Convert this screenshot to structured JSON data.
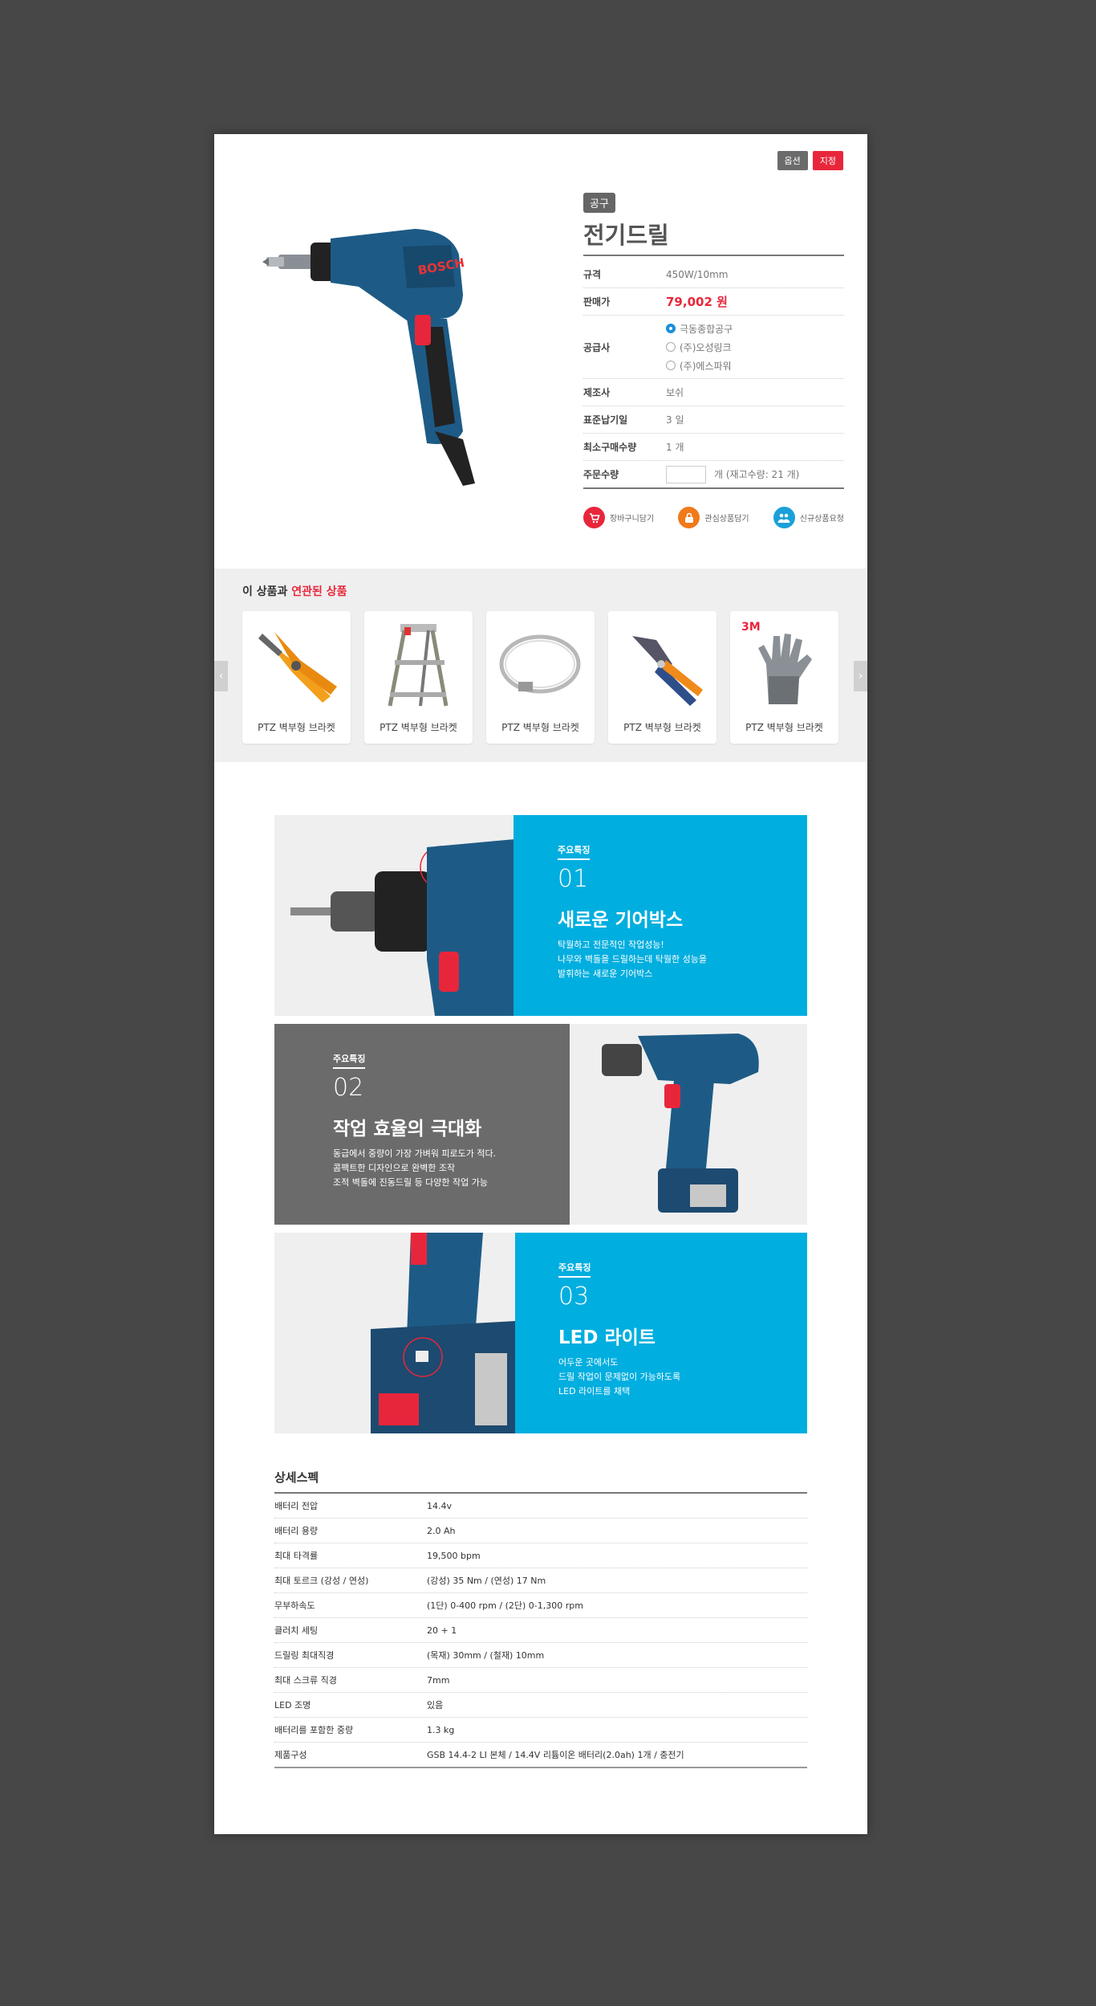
{
  "badges": {
    "option": "옵션",
    "designated": "지정"
  },
  "product": {
    "category": "공구",
    "title": "전기드릴",
    "spec_label": "규격",
    "spec_value": "450W/10mm",
    "price_label": "판매가",
    "price_value": "79,002 원",
    "supplier_label": "공급사",
    "suppliers": [
      {
        "name": "극동종합공구",
        "selected": true
      },
      {
        "name": "(주)오성링크",
        "selected": false
      },
      {
        "name": "(주)에스파워",
        "selected": false
      }
    ],
    "maker_label": "제조사",
    "maker_value": "보쉬",
    "leadtime_label": "표준납기일",
    "leadtime_value": "3 일",
    "minqty_label": "최소구매수량",
    "minqty_value": "1 개",
    "orderqty_label": "주문수량",
    "orderqty_suffix": "개 (재고수량: 21 개)"
  },
  "actions": {
    "cart": "장바구니담기",
    "wish": "관심상품담기",
    "request": "신규상품요청"
  },
  "related": {
    "title_prefix": "이 상품과 ",
    "title_highlight": "연관된 상품",
    "items": [
      {
        "name": "PTZ 벽부형 브라켓",
        "icon": "pliers"
      },
      {
        "name": "PTZ 벽부형 브라켓",
        "icon": "step-ladder"
      },
      {
        "name": "PTZ 벽부형 브라켓",
        "icon": "hose-clamp"
      },
      {
        "name": "PTZ 벽부형 브라켓",
        "icon": "crimping-tool"
      },
      {
        "name": "PTZ 벽부형 브라켓",
        "icon": "work-glove"
      }
    ]
  },
  "features": [
    {
      "label": "주요특징",
      "num": "01",
      "title": "새로운 기어박스",
      "desc": [
        "탁월하고 전문적인 작업성능!",
        "나무와 벽돌을 드릴하는데 탁월한 성능을",
        "발휘하는 새로운 기어박스"
      ]
    },
    {
      "label": "주요특징",
      "num": "02",
      "title": "작업 효율의 극대화",
      "desc": [
        "동급에서 중량이 가장 가벼워 피로도가 적다.",
        "콤팩트한 디자인으로 완벽한 조작",
        "조적 벽돌에 진동드릴 등 다양한 작업 가능"
      ]
    },
    {
      "label": "주요특징",
      "num": "03",
      "title": "LED 라이트",
      "desc": [
        "어두운 곳에서도",
        "드릴 작업이 문제없이 가능하도록",
        "LED 라이트를 채택"
      ]
    }
  ],
  "spec": {
    "title": "상세스펙",
    "rows": [
      {
        "k": "배터리 전압",
        "v": "14.4v"
      },
      {
        "k": "배터리 용량",
        "v": "2.0 Ah"
      },
      {
        "k": "최대 타격률",
        "v": "19,500 bpm"
      },
      {
        "k": "최대 토르크 (강성 / 연성)",
        "v": "(강성) 35 Nm / (연성) 17 Nm"
      },
      {
        "k": "무부하속도",
        "v": "(1단) 0-400 rpm / (2단) 0-1,300 rpm"
      },
      {
        "k": "클러치 세팅",
        "v": "20 + 1"
      },
      {
        "k": "드릴링 최대직경",
        "v": "(목재) 30mm / (철재) 10mm"
      },
      {
        "k": "최대 스크류 직경",
        "v": "7mm"
      },
      {
        "k": "LED 조명",
        "v": "있음"
      },
      {
        "k": "배터리를 포함한 중량",
        "v": "1.3 kg"
      },
      {
        "k": "제품구성",
        "v": "GSB 14.4-2 LI 본체 / 14.4V 리튬이온 배터리(2.0ah) 1개 / 충전기"
      }
    ]
  }
}
